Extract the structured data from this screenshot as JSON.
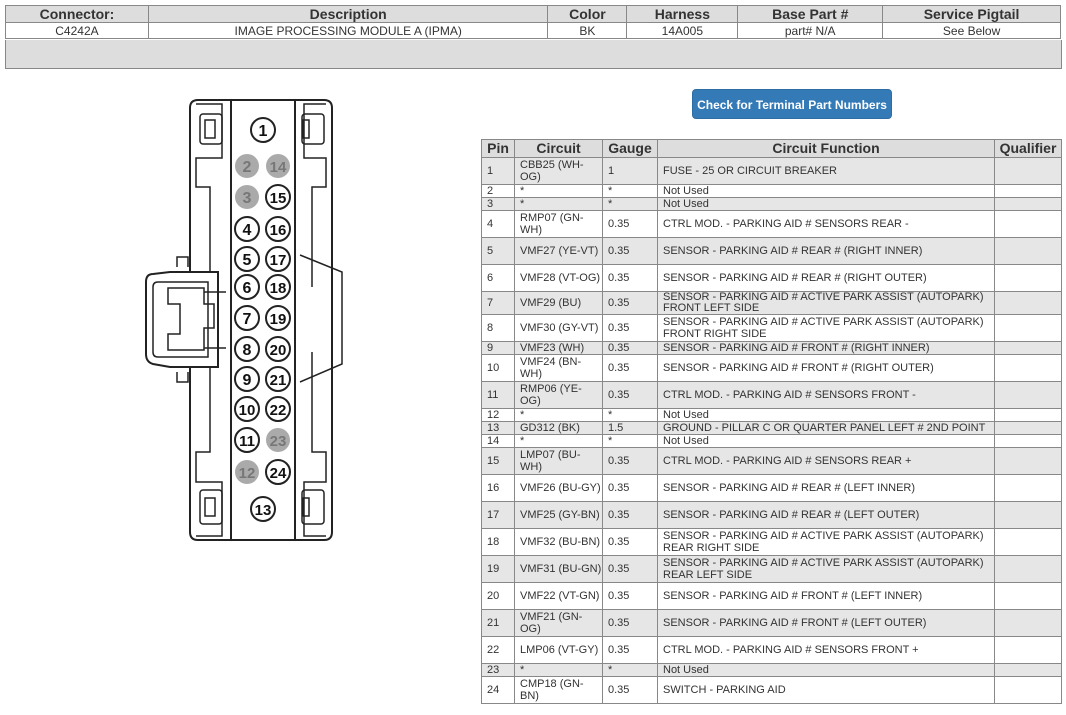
{
  "header": {
    "columns": [
      "Connector:",
      "Description",
      "Color",
      "Harness",
      "Base Part #",
      "Service Pigtail"
    ],
    "values": [
      "C4242A",
      "IMAGE PROCESSING MODULE A (IPMA)",
      "BK",
      "14A005",
      "part# N/A",
      "See Below"
    ]
  },
  "button_label": "Check for Terminal Part Numbers",
  "pin_table": {
    "headers": [
      "Pin",
      "Circuit",
      "Gauge",
      "Circuit Function",
      "Qualifier"
    ],
    "rows": [
      {
        "pin": "1",
        "circuit": "CBB25 (WH-OG)",
        "gauge": "1",
        "function": "FUSE - 25 OR CIRCUIT BREAKER",
        "qualifier": ""
      },
      {
        "pin": "2",
        "circuit": "*",
        "gauge": "*",
        "function": "Not Used",
        "qualifier": ""
      },
      {
        "pin": "3",
        "circuit": "*",
        "gauge": "*",
        "function": "Not Used",
        "qualifier": ""
      },
      {
        "pin": "4",
        "circuit": "RMP07 (GN-WH)",
        "gauge": "0.35",
        "function": "CTRL MOD. - PARKING AID # SENSORS REAR -",
        "qualifier": ""
      },
      {
        "pin": "5",
        "circuit": "VMF27 (YE-VT)",
        "gauge": "0.35",
        "function": "SENSOR - PARKING AID # REAR # (RIGHT INNER)",
        "qualifier": ""
      },
      {
        "pin": "6",
        "circuit": "VMF28 (VT-OG)",
        "gauge": "0.35",
        "function": "SENSOR - PARKING AID # REAR # (RIGHT OUTER)",
        "qualifier": ""
      },
      {
        "pin": "7",
        "circuit": "VMF29 (BU)",
        "gauge": "0.35",
        "function": "SENSOR - PARKING AID # ACTIVE PARK ASSIST (AUTOPARK) FRONT LEFT SIDE",
        "qualifier": ""
      },
      {
        "pin": "8",
        "circuit": "VMF30 (GY-VT)",
        "gauge": "0.35",
        "function": "SENSOR - PARKING AID # ACTIVE PARK ASSIST (AUTOPARK) FRONT RIGHT SIDE",
        "qualifier": ""
      },
      {
        "pin": "9",
        "circuit": "VMF23 (WH)",
        "gauge": "0.35",
        "function": "SENSOR - PARKING AID # FRONT # (RIGHT INNER)",
        "qualifier": ""
      },
      {
        "pin": "10",
        "circuit": "VMF24 (BN-WH)",
        "gauge": "0.35",
        "function": "SENSOR - PARKING AID # FRONT # (RIGHT OUTER)",
        "qualifier": ""
      },
      {
        "pin": "11",
        "circuit": "RMP06 (YE-OG)",
        "gauge": "0.35",
        "function": "CTRL MOD. - PARKING AID # SENSORS FRONT -",
        "qualifier": ""
      },
      {
        "pin": "12",
        "circuit": "*",
        "gauge": "*",
        "function": "Not Used",
        "qualifier": ""
      },
      {
        "pin": "13",
        "circuit": "GD312 (BK)",
        "gauge": "1.5",
        "function": "GROUND - PILLAR C OR QUARTER PANEL LEFT # 2ND POINT",
        "qualifier": ""
      },
      {
        "pin": "14",
        "circuit": "*",
        "gauge": "*",
        "function": "Not Used",
        "qualifier": ""
      },
      {
        "pin": "15",
        "circuit": "LMP07 (BU-WH)",
        "gauge": "0.35",
        "function": "CTRL MOD. - PARKING AID # SENSORS REAR +",
        "qualifier": ""
      },
      {
        "pin": "16",
        "circuit": "VMF26 (BU-GY)",
        "gauge": "0.35",
        "function": "SENSOR - PARKING AID # REAR # (LEFT INNER)",
        "qualifier": ""
      },
      {
        "pin": "17",
        "circuit": "VMF25 (GY-BN)",
        "gauge": "0.35",
        "function": "SENSOR - PARKING AID # REAR # (LEFT OUTER)",
        "qualifier": ""
      },
      {
        "pin": "18",
        "circuit": "VMF32 (BU-BN)",
        "gauge": "0.35",
        "function": "SENSOR - PARKING AID # ACTIVE PARK ASSIST (AUTOPARK) REAR RIGHT SIDE",
        "qualifier": ""
      },
      {
        "pin": "19",
        "circuit": "VMF31 (BU-GN)",
        "gauge": "0.35",
        "function": "SENSOR - PARKING AID # ACTIVE PARK ASSIST (AUTOPARK) REAR LEFT SIDE",
        "qualifier": ""
      },
      {
        "pin": "20",
        "circuit": "VMF22 (VT-GN)",
        "gauge": "0.35",
        "function": "SENSOR - PARKING AID # FRONT # (LEFT INNER)",
        "qualifier": ""
      },
      {
        "pin": "21",
        "circuit": "VMF21 (GN-OG)",
        "gauge": "0.35",
        "function": "SENSOR - PARKING AID # FRONT # (LEFT OUTER)",
        "qualifier": ""
      },
      {
        "pin": "22",
        "circuit": "LMP06 (VT-GY)",
        "gauge": "0.35",
        "function": "CTRL MOD. - PARKING AID # SENSORS FRONT +",
        "qualifier": ""
      },
      {
        "pin": "23",
        "circuit": "*",
        "gauge": "*",
        "function": "Not Used",
        "qualifier": ""
      },
      {
        "pin": "24",
        "circuit": "CMP18 (GN-BN)",
        "gauge": "0.35",
        "function": "SWITCH - PARKING AID",
        "qualifier": ""
      }
    ]
  },
  "connector": {
    "pins": [
      {
        "label": "1",
        "unused": false
      },
      {
        "label": "2",
        "unused": true
      },
      {
        "label": "14",
        "unused": true
      },
      {
        "label": "3",
        "unused": true
      },
      {
        "label": "15",
        "unused": false
      },
      {
        "label": "4",
        "unused": false
      },
      {
        "label": "16",
        "unused": false
      },
      {
        "label": "5",
        "unused": false
      },
      {
        "label": "17",
        "unused": false
      },
      {
        "label": "6",
        "unused": false
      },
      {
        "label": "18",
        "unused": false
      },
      {
        "label": "7",
        "unused": false
      },
      {
        "label": "19",
        "unused": false
      },
      {
        "label": "8",
        "unused": false
      },
      {
        "label": "20",
        "unused": false
      },
      {
        "label": "9",
        "unused": false
      },
      {
        "label": "21",
        "unused": false
      },
      {
        "label": "10",
        "unused": false
      },
      {
        "label": "22",
        "unused": false
      },
      {
        "label": "11",
        "unused": false
      },
      {
        "label": "23",
        "unused": true
      },
      {
        "label": "12",
        "unused": true
      },
      {
        "label": "24",
        "unused": false
      },
      {
        "label": "13",
        "unused": false
      }
    ]
  },
  "colors": {
    "button": "#337ab7",
    "header_bg": "#dddddd",
    "unused_pin": "#aaaaaa"
  }
}
